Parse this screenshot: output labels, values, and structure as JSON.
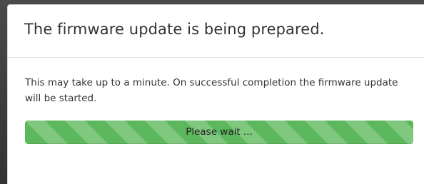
{
  "dialog": {
    "title": "The firmware update is being prepared.",
    "message": "This may take up to a minute. On successful completion the firmware update will be started.",
    "progress": {
      "label": "Please wait ...",
      "fraction": 1.0,
      "color": "#5cb85c"
    }
  }
}
